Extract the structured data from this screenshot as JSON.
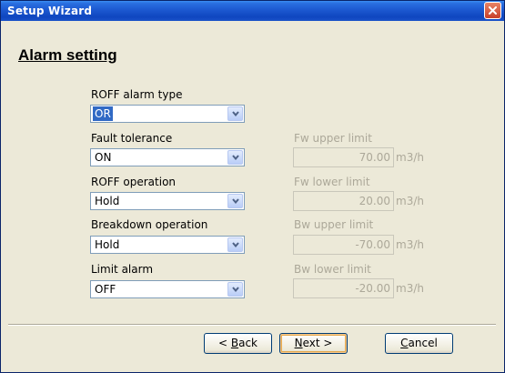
{
  "window": {
    "title": "Setup Wizard"
  },
  "page": {
    "heading": "Alarm setting"
  },
  "fields": {
    "roff_alarm_type": {
      "label": "ROFF alarm type",
      "value": "OR"
    },
    "fault_tolerance": {
      "label": "Fault tolerance",
      "value": "ON"
    },
    "roff_operation": {
      "label": "ROFF operation",
      "value": "Hold"
    },
    "breakdown_operation": {
      "label": "Breakdown operation",
      "value": "Hold"
    },
    "limit_alarm": {
      "label": "Limit alarm",
      "value": "OFF"
    }
  },
  "limits": {
    "unit": "m3/h",
    "fw_upper": {
      "label": "Fw upper limit",
      "value": "70.00"
    },
    "fw_lower": {
      "label": "Fw lower limit",
      "value": "20.00"
    },
    "bw_upper": {
      "label": "Bw upper limit",
      "value": "-70.00"
    },
    "bw_lower": {
      "label": "Bw lower limit",
      "value": "-20.00"
    }
  },
  "buttons": {
    "back": {
      "prefix": "< ",
      "mnemonic": "B",
      "rest": "ack"
    },
    "next": {
      "mnemonic": "N",
      "rest": "ext >"
    },
    "cancel": {
      "mnemonic": "C",
      "rest": "ancel"
    }
  },
  "icons": {
    "close": "close-icon",
    "dropdown": "chevron-down-icon"
  }
}
